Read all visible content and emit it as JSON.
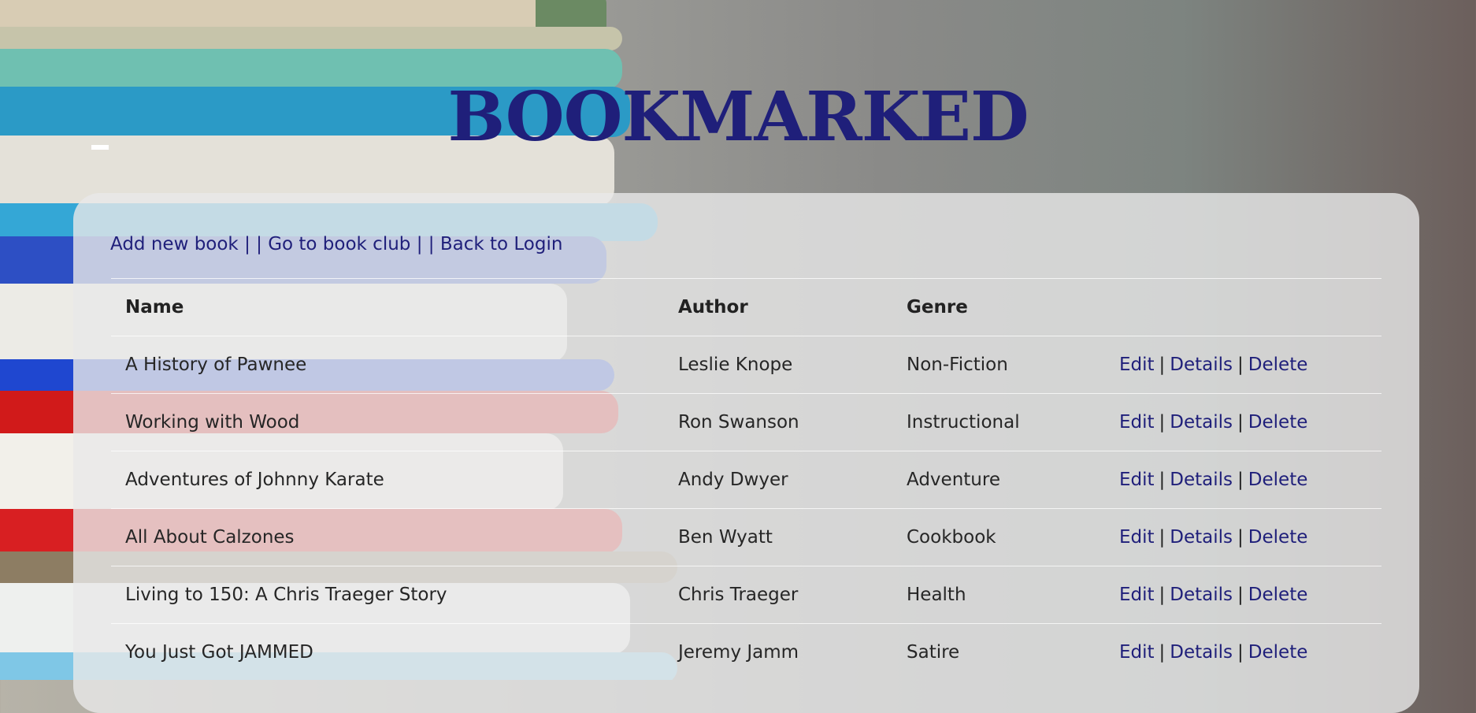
{
  "header": {
    "title": "BOOKMARKED"
  },
  "nav": {
    "add_book": "Add new book",
    "book_club": "Go to book club",
    "back_login": "Back to Login",
    "separator": "| |"
  },
  "table": {
    "headers": [
      "Name",
      "Author",
      "Genre",
      ""
    ],
    "rows": [
      {
        "name": "A History of Pawnee",
        "author": "Leslie Knope",
        "genre": "Non-Fiction"
      },
      {
        "name": "Working with Wood",
        "author": "Ron Swanson",
        "genre": "Instructional"
      },
      {
        "name": "Adventures of Johnny Karate",
        "author": "Andy Dwyer",
        "genre": "Adventure"
      },
      {
        "name": "All About Calzones",
        "author": "Ben Wyatt",
        "genre": "Cookbook"
      },
      {
        "name": "Living to 150: A Chris Traeger Story",
        "author": "Chris Traeger",
        "genre": "Health"
      },
      {
        "name": "You Just Got JAMMED",
        "author": "Jeremy Jamm",
        "genre": "Satire"
      }
    ],
    "actions": {
      "edit": "Edit",
      "details": "Details",
      "delete": "Delete",
      "separator": "|"
    }
  },
  "colors": {
    "title": "#1f1f7a",
    "link": "#1f1f7a",
    "panel": "#e8e8e8"
  }
}
